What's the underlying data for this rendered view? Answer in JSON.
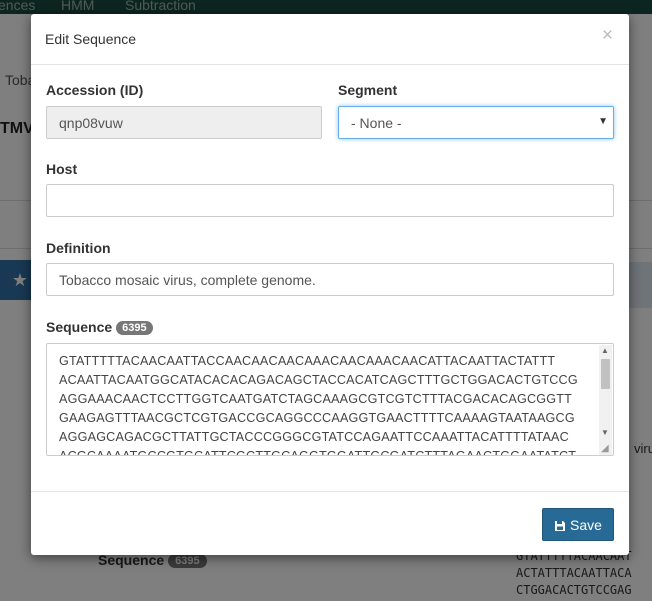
{
  "background": {
    "nav": {
      "item_1": "ences",
      "item_2": "HMM",
      "item_3": "Subtraction"
    },
    "breadcrumb_fragment": "Toba",
    "title_fragment": "TMV",
    "right_text_fragment": "virus",
    "sequence": {
      "label": "Sequence",
      "count": "6395",
      "preview": "GTATTTTTACAACAAT\nACTATTTACAATTACA\nCTGGACACTGTCCGAG"
    }
  },
  "modal": {
    "title": "Edit Sequence",
    "close_label": "×",
    "accession": {
      "label": "Accession (ID)",
      "value": "qnp08vuw"
    },
    "segment": {
      "label": "Segment",
      "value": "- None -"
    },
    "host": {
      "label": "Host",
      "value": ""
    },
    "definition": {
      "label": "Definition",
      "value": "Tobacco mosaic virus, complete genome."
    },
    "sequence": {
      "label": "Sequence",
      "count": "6395",
      "value": "GTATTTTTACAACAATTACCAACAACAACAAACAACAAACAACATTACAATTACTATTT\nACAATTACAATGGCATACACACAGACAGCTACCACATCAGCTTTGCTGGACACTGTCCG\nAGGAAACAACTCCTTGGTCAATGATCTAGCAAAGCGTCGTCTTTACGACACAGCGGTT\nGAAGAGTTTAACGCTCGTGACCGCAGGCCCAAGGTGAACTTTTCAAAAGTAATAAGCG\nAGGAGCAGACGCTTATTGCTACCCGGGCGTATCCAGAATTCCAAATTACATTTTATAAC\nACGCAAAATGCCGTGCATTCGCTTGCAGGTGGATTGCGATCTTTAGAACTGGAATATCT"
    },
    "save_label": "Save"
  },
  "colors": {
    "primary": "#276a96",
    "nav": "#1b4a40",
    "focus": "#66afe9"
  },
  "icons": {
    "close": "close-icon",
    "save": "floppy-disk-icon",
    "select": "caret-down-icon"
  }
}
